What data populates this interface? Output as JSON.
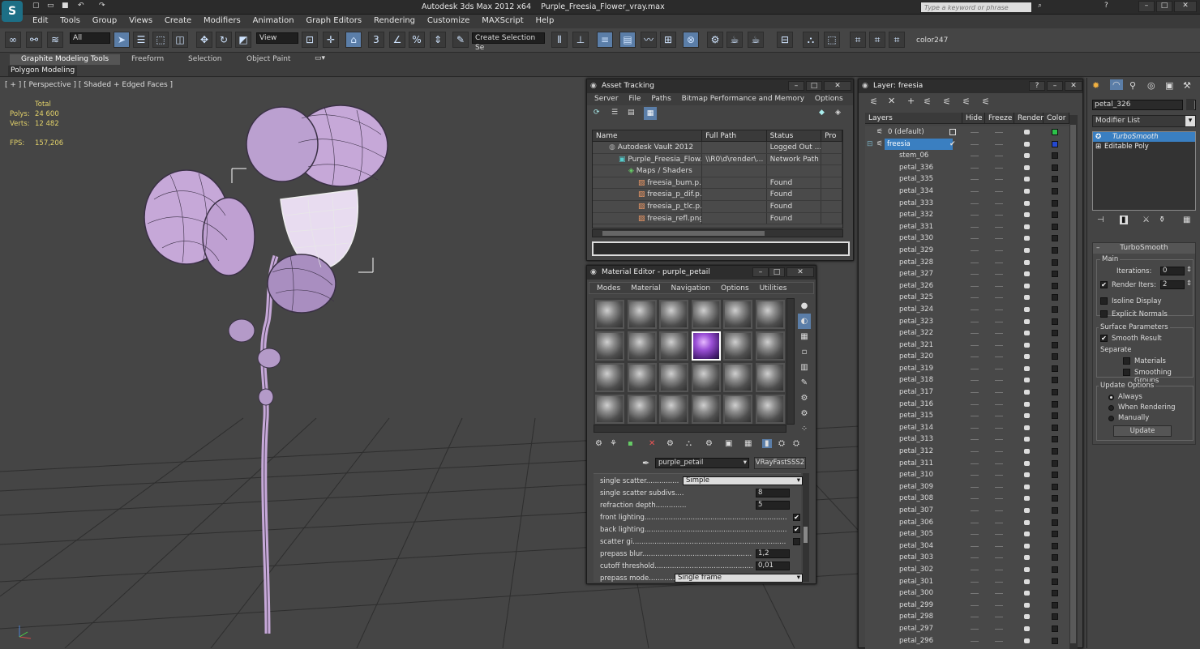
{
  "titlebar": {
    "app": "Autodesk 3ds Max  2012 x64",
    "file": "Purple_Freesia_Flower_vray.max",
    "search_placeholder": "Type a keyword or phrase"
  },
  "menu": [
    "Edit",
    "Tools",
    "Group",
    "Views",
    "Create",
    "Modifiers",
    "Animation",
    "Graph Editors",
    "Rendering",
    "Customize",
    "MAXScript",
    "Help"
  ],
  "toolbar": {
    "filter": "All",
    "refcoord": "View",
    "selset": "Create Selection Se",
    "color_label": "color247"
  },
  "ribbon": {
    "tabs": [
      "Graphite Modeling Tools",
      "Freeform",
      "Selection",
      "Object Paint"
    ],
    "sub": "Polygon Modeling"
  },
  "viewport": {
    "label": "[ + ] [ Perspective ] [ Shaded + Edged Faces ]",
    "stats": {
      "total_label": "Total",
      "polys_label": "Polys:",
      "polys": "24 600",
      "verts_label": "Verts:",
      "verts": "12 482",
      "fps_label": "FPS:",
      "fps": "157,206"
    }
  },
  "asset_tracking": {
    "title": "Asset Tracking",
    "menu": [
      "Server",
      "File",
      "Paths",
      "Bitmap Performance and Memory",
      "Options"
    ],
    "columns": [
      "Name",
      "Full Path",
      "Status",
      "Pro"
    ],
    "rows": [
      {
        "name": "Autodesk Vault 2012",
        "path": "",
        "status": "Logged Out ..."
      },
      {
        "name": "Purple_Freesia_Flow...",
        "path": "\\\\R0\\d\\render\\...",
        "status": "Network Path"
      },
      {
        "name": "Maps / Shaders",
        "path": "",
        "status": ""
      },
      {
        "name": "freesia_bum.p...",
        "path": "",
        "status": "Found"
      },
      {
        "name": "freesia_p_dif.p...",
        "path": "",
        "status": "Found"
      },
      {
        "name": "freesia_p_tlc.p...",
        "path": "",
        "status": "Found"
      },
      {
        "name": "freesia_refl.png",
        "path": "",
        "status": "Found"
      }
    ]
  },
  "material_editor": {
    "title": "Material Editor - purple_petail",
    "menu": [
      "Modes",
      "Material",
      "Navigation",
      "Options",
      "Utilities"
    ],
    "material_name": "purple_petail",
    "material_type": "VRayFastSSS2",
    "params": [
      {
        "label": "single scatter...............",
        "value": "Simple",
        "kind": "dropdown"
      },
      {
        "label": "single scatter subdivs....",
        "value": "8",
        "kind": "spinner"
      },
      {
        "label": "refraction depth..............",
        "value": "5",
        "kind": "spinner"
      },
      {
        "label": "front lighting.................................................................",
        "value": "✔",
        "kind": "check"
      },
      {
        "label": "back lighting..................................................................",
        "value": "✔",
        "kind": "check"
      },
      {
        "label": "scatter gi.......................................................................",
        "value": "",
        "kind": "check"
      },
      {
        "label": "prepass blur.........................................................",
        "value": "1,2",
        "kind": "spinner"
      },
      {
        "label": "cutoff threshold...................................................",
        "value": "0,01",
        "kind": "spinner"
      },
      {
        "label": "prepass mode...............",
        "value": "Single frame",
        "kind": "dropdown"
      }
    ]
  },
  "layer_panel": {
    "title": "Layer: freesia",
    "columns": [
      "Layers",
      "Hide",
      "Freeze",
      "Render",
      "Color"
    ],
    "default_layer": "0 (default)",
    "active_layer": "freesia",
    "items": [
      "stem_06",
      "petal_336",
      "petal_335",
      "petal_334",
      "petal_333",
      "petal_332",
      "petal_331",
      "petal_330",
      "petal_329",
      "petal_328",
      "petal_327",
      "petal_326",
      "petal_325",
      "petal_324",
      "petal_323",
      "petal_322",
      "petal_321",
      "petal_320",
      "petal_319",
      "petal_318",
      "petal_317",
      "petal_316",
      "petal_315",
      "petal_314",
      "petal_313",
      "petal_312",
      "petal_311",
      "petal_310",
      "petal_309",
      "petal_308",
      "petal_307",
      "petal_306",
      "petal_305",
      "petal_304",
      "petal_303",
      "petal_302",
      "petal_301",
      "petal_300",
      "petal_299",
      "petal_298",
      "petal_297",
      "petal_296"
    ]
  },
  "command_panel": {
    "object_name": "petal_326",
    "modifier_list": "Modifier List",
    "stack": [
      "TurboSmooth",
      "Editable Poly"
    ],
    "rollout": "TurboSmooth",
    "main_label": "Main",
    "iterations_label": "Iterations:",
    "iterations": "0",
    "render_iters_label": "Render Iters:",
    "render_iters": "2",
    "isoline": "Isoline Display",
    "explicit": "Explicit Normals",
    "surface_label": "Surface Parameters",
    "smooth_result": "Smooth Result",
    "separate": "Separate",
    "materials": "Materials",
    "smoothing_groups": "Smoothing Groups",
    "update_options": "Update Options",
    "always": "Always",
    "when_rendering": "When Rendering",
    "manually": "Manually",
    "update_button": "Update"
  },
  "colors": {
    "accent": "#5b7ea8",
    "flower": "#c6a8d8",
    "selection": "#3a7fc1"
  }
}
